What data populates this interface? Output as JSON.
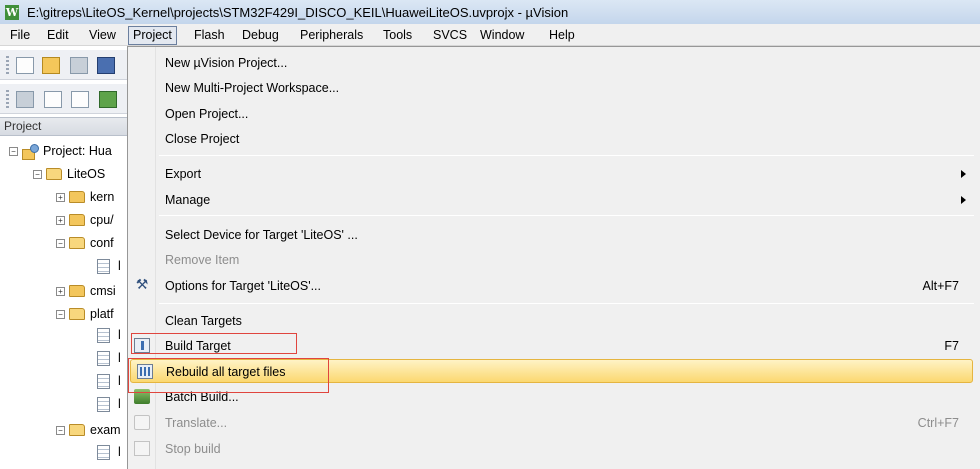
{
  "window": {
    "title": "E:\\gitreps\\LiteOS_Kernel\\projects\\STM32F429I_DISCO_KEIL\\HuaweiLiteOS.uvprojx - µVision",
    "icon_glyph": "W"
  },
  "menubar": [
    {
      "label": "File"
    },
    {
      "label": "Edit"
    },
    {
      "label": "View"
    },
    {
      "label": "Project",
      "active": true
    },
    {
      "label": "Flash"
    },
    {
      "label": "Debug"
    },
    {
      "label": "Peripherals"
    },
    {
      "label": "Tools"
    },
    {
      "label": "SVCS"
    },
    {
      "label": "Window"
    },
    {
      "label": "Help"
    }
  ],
  "project_panel": {
    "header": "Project",
    "tree": [
      {
        "label": "Project: Hua",
        "expander": "−",
        "icon": "project-icon"
      },
      {
        "label": "LiteOS",
        "expander": "−",
        "icon": "open-folder-icon"
      },
      {
        "label": "kern",
        "expander": "+",
        "icon": "folder-icon"
      },
      {
        "label": "cpu/",
        "expander": "+",
        "icon": "folder-icon"
      },
      {
        "label": "conf",
        "expander": "−",
        "icon": "open-folder-icon"
      },
      {
        "label": "l",
        "icon": "file-icon"
      },
      {
        "label": "cmsi",
        "expander": "+",
        "icon": "folder-icon"
      },
      {
        "label": "platf",
        "expander": "−",
        "icon": "open-folder-icon"
      },
      {
        "label": "l",
        "icon": "file-icon"
      },
      {
        "label": "l",
        "icon": "file-icon"
      },
      {
        "label": "l",
        "icon": "file-icon"
      },
      {
        "label": "l",
        "icon": "file-icon"
      },
      {
        "label": "exam",
        "expander": "−",
        "icon": "open-folder-icon"
      },
      {
        "label": "l",
        "icon": "file-icon"
      }
    ]
  },
  "project_menu": {
    "items": [
      {
        "label": "New µVision Project..."
      },
      {
        "label": "New Multi-Project Workspace..."
      },
      {
        "label": "Open Project..."
      },
      {
        "label": "Close Project"
      },
      {
        "label": "Export",
        "submenu": true
      },
      {
        "label": "Manage",
        "submenu": true
      },
      {
        "label": "Select Device for Target 'LiteOS' ..."
      },
      {
        "label": "Remove Item",
        "disabled": true
      },
      {
        "label": "Options for Target 'LiteOS'...",
        "shortcut": "Alt+F7",
        "icon": "options-icon"
      },
      {
        "label": "Clean Targets"
      },
      {
        "label": "Build Target",
        "shortcut": "F7",
        "icon": "build-icon"
      },
      {
        "label": "Rebuild all target files",
        "icon": "rebuild-icon",
        "highlighted": true
      },
      {
        "label": "Batch Build...",
        "icon": "batch-build-icon"
      },
      {
        "label": "Translate...",
        "shortcut": "Ctrl+F7",
        "disabled": true,
        "icon": "translate-icon"
      },
      {
        "label": "Stop build",
        "disabled": true,
        "icon": "stop-build-icon"
      }
    ],
    "options_glyph": "⚒"
  },
  "colors": {
    "highlight": "#fbd870",
    "annotation_box": "#e0453e",
    "menubar": "#f0f0f0",
    "titlebar": "#c4d6ec"
  }
}
